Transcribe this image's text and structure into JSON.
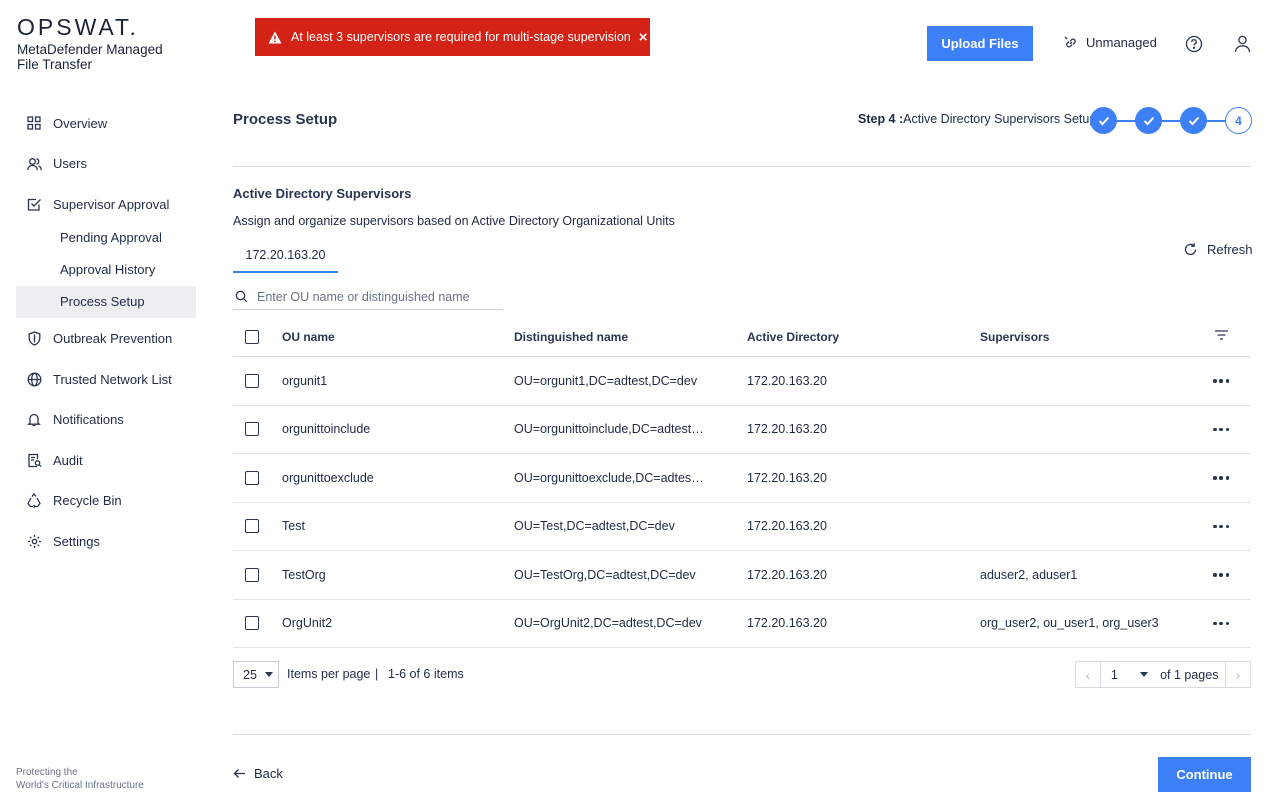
{
  "brand": {
    "logo": "OPSWAT.",
    "product": "MetaDefender Managed File Transfer",
    "tagline_line1": "Protecting the",
    "tagline_line2": "World's Critical Infrastructure"
  },
  "alert": {
    "message": "At least 3 supervisors are required for multi-stage supervision",
    "close": "×",
    "color": "#d32316"
  },
  "header": {
    "upload_label": "Upload Files",
    "unmanaged_label": "Unmanaged",
    "accent_color": "#3d7ff5"
  },
  "sidebar": {
    "items": [
      {
        "label": "Overview",
        "icon": "grid-icon"
      },
      {
        "label": "Users",
        "icon": "users-icon"
      },
      {
        "label": "Supervisor Approval",
        "icon": "checkbox-approval-icon"
      },
      {
        "label": "Outbreak Prevention",
        "icon": "shield-icon"
      },
      {
        "label": "Trusted Network List",
        "icon": "globe-icon"
      },
      {
        "label": "Notifications",
        "icon": "bell-icon"
      },
      {
        "label": "Audit",
        "icon": "audit-icon"
      },
      {
        "label": "Recycle Bin",
        "icon": "recycle-icon"
      },
      {
        "label": "Settings",
        "icon": "gear-icon"
      }
    ],
    "sub_items": [
      {
        "label": "Pending Approval"
      },
      {
        "label": "Approval History"
      },
      {
        "label": "Process Setup",
        "active": true
      }
    ]
  },
  "main": {
    "title": "Process Setup",
    "step_prefix": "Step 4 :",
    "step_name": "Active Directory Supervisors Setup",
    "steps": [
      {
        "state": "done"
      },
      {
        "state": "done"
      },
      {
        "state": "done"
      },
      {
        "state": "current",
        "label": "4"
      }
    ],
    "section_title": "Active Directory Supervisors",
    "section_desc": "Assign and organize supervisors based on Active Directory Organizational Units",
    "tab_label": "172.20.163.20",
    "refresh_label": "Refresh",
    "search": {
      "placeholder": "Enter OU name or distinguished name",
      "value": ""
    }
  },
  "table": {
    "columns": {
      "ou": "OU name",
      "dn": "Distinguished name",
      "ad": "Active Directory",
      "sup": "Supervisors"
    },
    "rows": [
      {
        "ou": "orgunit1",
        "dn": "OU=orgunit1,DC=adtest,DC=dev",
        "ad": "172.20.163.20",
        "sup": ""
      },
      {
        "ou": "orgunittoinclude",
        "dn": "OU=orgunittoinclude,DC=adtest,...",
        "ad": "172.20.163.20",
        "sup": ""
      },
      {
        "ou": "orgunittoexclude",
        "dn": "OU=orgunittoexclude,DC=adtest...",
        "ad": "172.20.163.20",
        "sup": ""
      },
      {
        "ou": "Test",
        "dn": "OU=Test,DC=adtest,DC=dev",
        "ad": "172.20.163.20",
        "sup": ""
      },
      {
        "ou": "TestOrg",
        "dn": "OU=TestOrg,DC=adtest,DC=dev",
        "ad": "172.20.163.20",
        "sup": "aduser2, aduser1"
      },
      {
        "ou": "OrgUnit2",
        "dn": "OU=OrgUnit2,DC=adtest,DC=dev",
        "ad": "172.20.163.20",
        "sup": "org_user2, ou_user1, org_user3"
      }
    ]
  },
  "pagination": {
    "per_page": "25",
    "per_page_label": "Items per page",
    "separator": "|",
    "range": "1-6 of 6 items",
    "current_page": "1",
    "of_pages": "of 1 pages"
  },
  "footer": {
    "back_label": "Back",
    "continue_label": "Continue"
  }
}
